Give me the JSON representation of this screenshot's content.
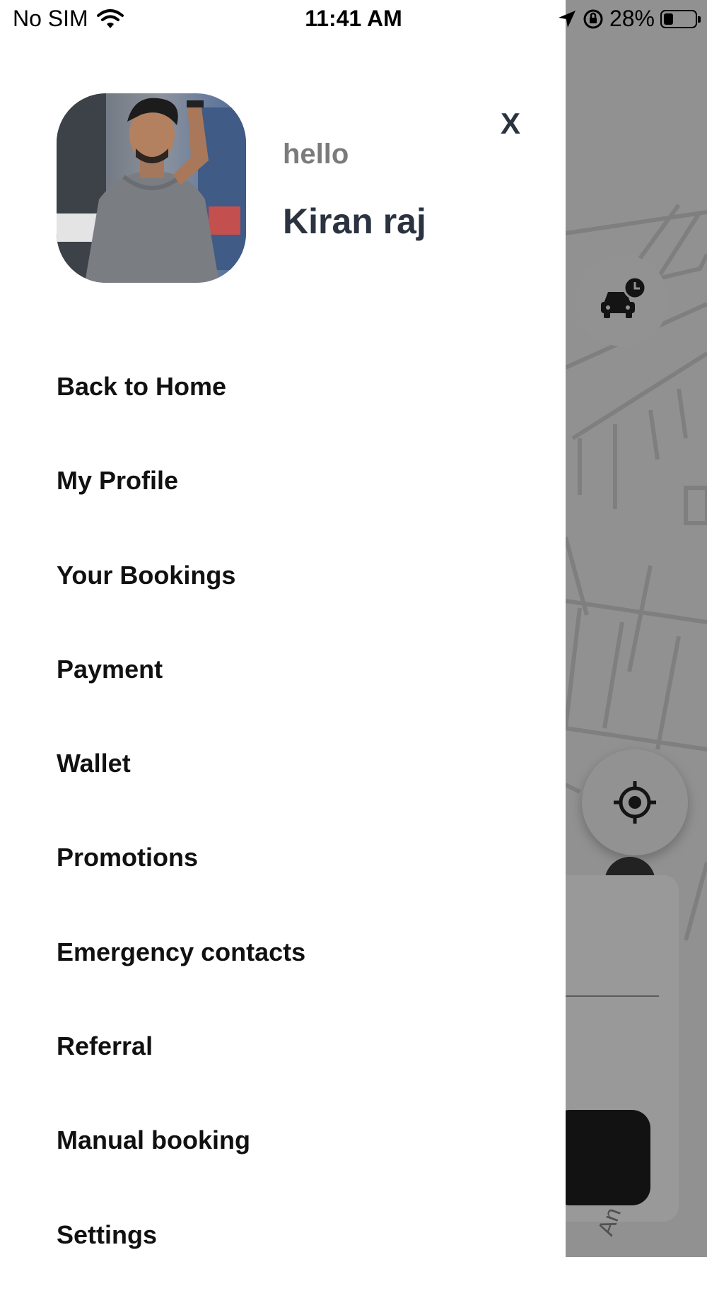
{
  "status_bar": {
    "carrier": "No SIM",
    "time": "11:41 AM",
    "battery": "28%",
    "battery_level": 0.28,
    "icons": [
      "wifi-icon",
      "location-arrow-icon",
      "orientation-lock-icon",
      "battery-icon"
    ]
  },
  "drawer": {
    "close_label": "X",
    "greeting": "hello",
    "user_name": "Kiran raj",
    "menu": [
      {
        "label": "Back to Home"
      },
      {
        "label": "My Profile"
      },
      {
        "label": "Your Bookings"
      },
      {
        "label": "Payment"
      },
      {
        "label": "Wallet"
      },
      {
        "label": "Promotions"
      },
      {
        "label": "Emergency contacts"
      },
      {
        "label": "Referral"
      },
      {
        "label": "Manual booking"
      },
      {
        "label": "Settings"
      }
    ]
  },
  "map": {
    "partial_label": "An",
    "icons": [
      "scheduled-ride-icon",
      "locate-me-icon"
    ]
  },
  "colors": {
    "drawer_bg": "#ffffff",
    "name_text": "#2b3240",
    "greeting_text": "#7b7b7b",
    "menu_text": "#111111",
    "overlay": "rgba(0,0,0,0.40)"
  }
}
